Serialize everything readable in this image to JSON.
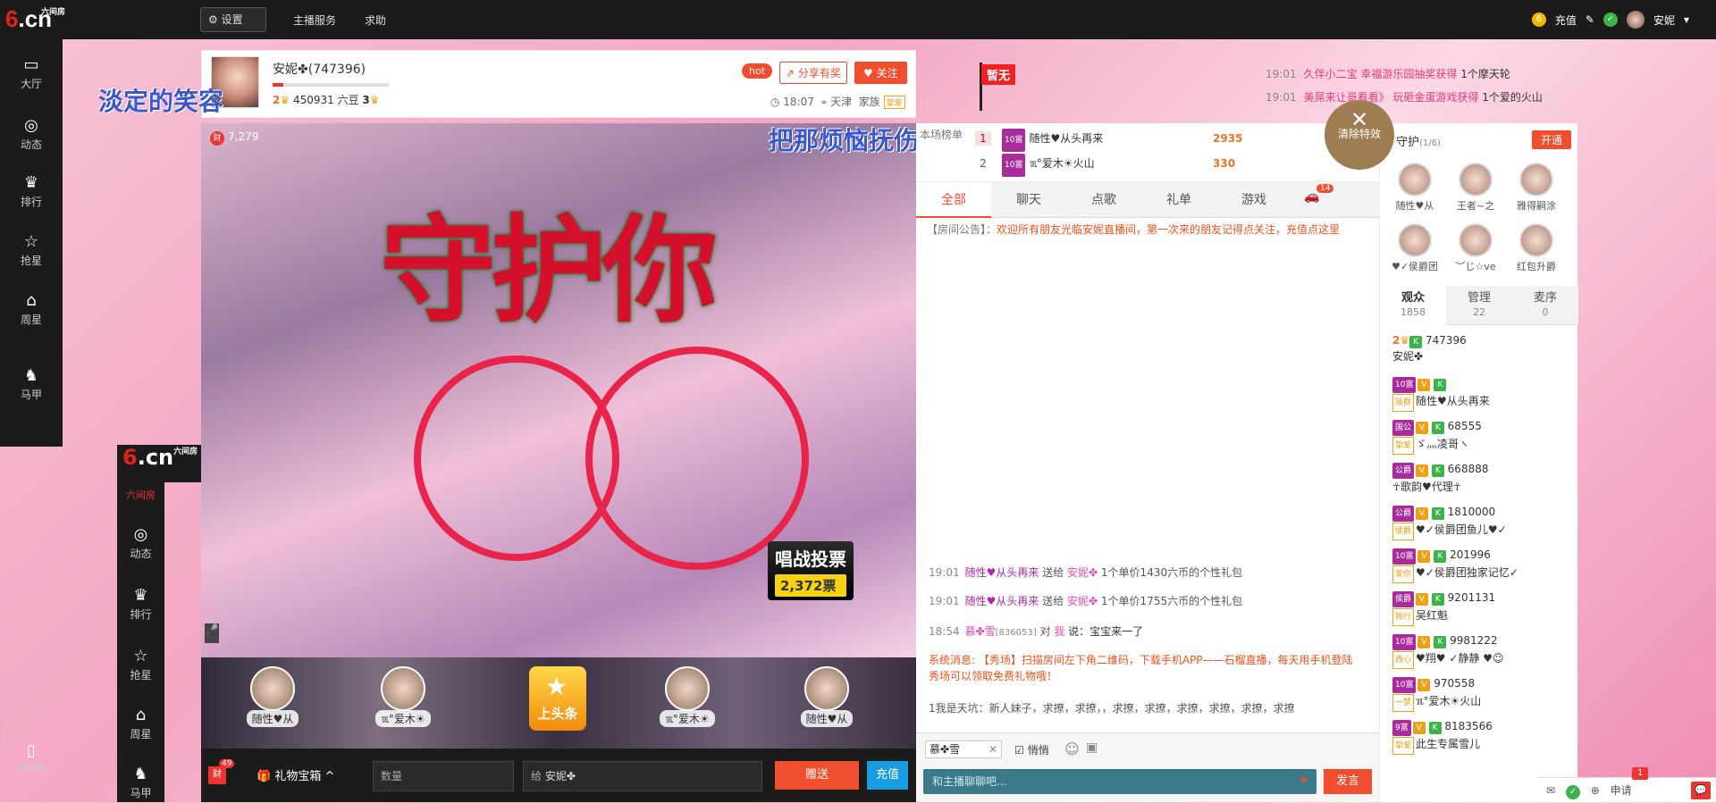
{
  "topbar": {
    "logo": "6",
    "logo_suffix": ".cn",
    "logo_small": "六间房",
    "settings": "设置",
    "anchor_service": "主播服务",
    "help": "求助",
    "recharge": "充值",
    "username": "安妮",
    "coin_glyph": "6",
    "check_glyph": "✓"
  },
  "leftnav": [
    {
      "icon": "tv-icon",
      "glyph": "▭",
      "label": "大厅"
    },
    {
      "icon": "compass-icon",
      "glyph": "◎",
      "label": "动态"
    },
    {
      "icon": "crown-icon",
      "glyph": "♛",
      "label": "排行"
    },
    {
      "icon": "star-icon",
      "glyph": "☆",
      "label": "抢星"
    },
    {
      "icon": "basket-icon",
      "glyph": "⌂",
      "label": "周星"
    },
    {
      "icon": "shirt-icon",
      "glyph": "♞",
      "label": "马甲"
    }
  ],
  "leftnav2": {
    "logo": "6",
    "logo_suffix": ".cn",
    "logo_small": "六间房",
    "hall": "六间房",
    "items": [
      {
        "icon": "compass-icon",
        "glyph": "◎",
        "label": "动态"
      },
      {
        "icon": "crown-icon",
        "glyph": "♛",
        "label": "排行"
      },
      {
        "icon": "star-icon",
        "glyph": "☆",
        "label": "抢星"
      },
      {
        "icon": "basket-icon",
        "glyph": "⌂",
        "label": "周星"
      },
      {
        "icon": "shirt-icon",
        "glyph": "♞",
        "label": "马甲"
      }
    ]
  },
  "mobile": {
    "glyph": "▯",
    "label": "移动版"
  },
  "anchor": {
    "name": "安妮✤",
    "id": "(747396)",
    "level": "2",
    "beans": "450931 六豆",
    "rank": "3",
    "hot": "hot",
    "share": "分享有奖",
    "follow": "关注",
    "time": "18:07",
    "city": "天津",
    "family": "家族",
    "family_tag": "挚爱"
  },
  "zanwu": "暂无",
  "marquee": [
    {
      "time": "19:01",
      "text": "久伴小二宝 幸福游乐园抽奖获得",
      "prize": "1个摩天轮"
    },
    {
      "time": "19:01",
      "text": "美屌来让哥看看》 玩砸金蛋游戏获得",
      "prize": "1个爱的火山"
    }
  ],
  "overlay": {
    "left": "淡定的笑容",
    "right": "把那烦恼抚伤"
  },
  "video": {
    "wealth_tag": "财",
    "wealth": "7,279",
    "big_text": "守护你",
    "vote_title": "唱战投票",
    "vote_count": "2,372票"
  },
  "strip": [
    {
      "name": "随性♥从"
    },
    {
      "name": "ℼ°爱木☀"
    },
    {
      "name": "ℼ°爱木☀"
    },
    {
      "name": "随性♥从"
    }
  ],
  "toutiao": "上头条",
  "giftbar": {
    "fortune_tag": "财",
    "fortune_badge": "49",
    "treasure": "礼物宝箱",
    "qty_placeholder": "数量",
    "to_label": "给",
    "to_user": "安妮✤",
    "send": "赠送",
    "recharge": "充值"
  },
  "rank": {
    "label": "本场榜单",
    "rows": [
      {
        "n": "1",
        "lv": "10富",
        "name": "随性♥从头再来",
        "val": "2935"
      },
      {
        "n": "2",
        "lv": "10富",
        "name": "ℼ°爱木☀火山",
        "val": "330"
      }
    ]
  },
  "tabs": [
    "全部",
    "聊天",
    "点歌",
    "礼单",
    "游戏"
  ],
  "car_badge": "14",
  "car_glyph": "🚗",
  "notice": {
    "label": "【房间公告】：",
    "text": "欢迎所有朋友光临安妮直播间，第一次来的朋友记得点关注，充值点这里"
  },
  "messages": [
    {
      "time": "19:01",
      "user": "随性♥从头再来",
      "action": "送给",
      "to": "安妮✤",
      "text": "1个单价1430六币的个性礼包"
    },
    {
      "time": "19:01",
      "user": "随性♥从头再来",
      "action": "送给",
      "to": "安妮✤",
      "text": "1个单价1755六币的个性礼包"
    },
    {
      "time": "18:54",
      "user": "慕✤雪",
      "uid": "[836053]",
      "action": "对",
      "to": "我",
      "text": "说：宝宝来一了"
    }
  ],
  "sysmsg": "系统消息: 【秀场】扫描房间左下角二维码，下载手机APP——石榴直播，每天用手机登陆秀场可以领取免费礼物哦！",
  "lastmsg": "1我是天坑：新人妹子，求撩，求撩，，求撩，求撩，求撩，求撩，求撩，求撩",
  "chatinput": {
    "to": "慕✤雪",
    "quiet": "悄悄",
    "placeholder": "和主播聊聊吧...",
    "send": "发言"
  },
  "guard": {
    "title": "守护",
    "count": "(1/6)",
    "open": "开通",
    "members": [
      "随性♥从",
      "王者~之",
      "雅得嗣涂",
      "♥✓侯爵团",
      "︶じ☆ve",
      "红包升爵"
    ]
  },
  "audience_tabs": [
    {
      "label": "观众",
      "count": "1858"
    },
    {
      "label": "管理",
      "count": "22"
    },
    {
      "label": "麦序",
      "count": "0"
    }
  ],
  "viewers": [
    {
      "lv": "2",
      "id": "747396",
      "name": "安妮✤"
    },
    {
      "lv": "10富",
      "id": "",
      "name": "随性♥从头再来",
      "fam": "陵群"
    },
    {
      "lv": "国公",
      "id": "68555",
      "name": "ゞ灬凌哥ヽ",
      "fam": "挚爱"
    },
    {
      "lv": "公爵",
      "id": "668888",
      "name": "☥歌韵♥代理☥"
    },
    {
      "lv": "公爵",
      "id": "1810000",
      "name": "♥✓侯爵团鱼儿♥✓",
      "fam": "侯爵"
    },
    {
      "lv": "10富",
      "id": "201996",
      "name": "♥✓侯爵团独家记忆✓",
      "fam": "爱你"
    },
    {
      "lv": "侯爵",
      "id": "9201131",
      "name": "吴红魁",
      "fam": "独行"
    },
    {
      "lv": "10富",
      "id": "9981222",
      "name": "♥翔♥ ✓静静 ♥☺",
      "fam": "西心"
    },
    {
      "lv": "10富",
      "id": "970558",
      "name": "ℼ°爱木☀火山",
      "fam": "一梦"
    },
    {
      "lv": "9富",
      "id": "8183566",
      "name": "此生专属雪儿",
      "fam": "挚爱"
    }
  ],
  "clear_effects": {
    "glyph": "✕",
    "label": "清除特效"
  },
  "bottomright": {
    "apply": "申请",
    "badge": "1",
    "chat_glyph": "💬"
  },
  "colors": {
    "accent": "#f04e2f",
    "dark": "#1b1b1b",
    "blue": "#1a9ce0"
  }
}
